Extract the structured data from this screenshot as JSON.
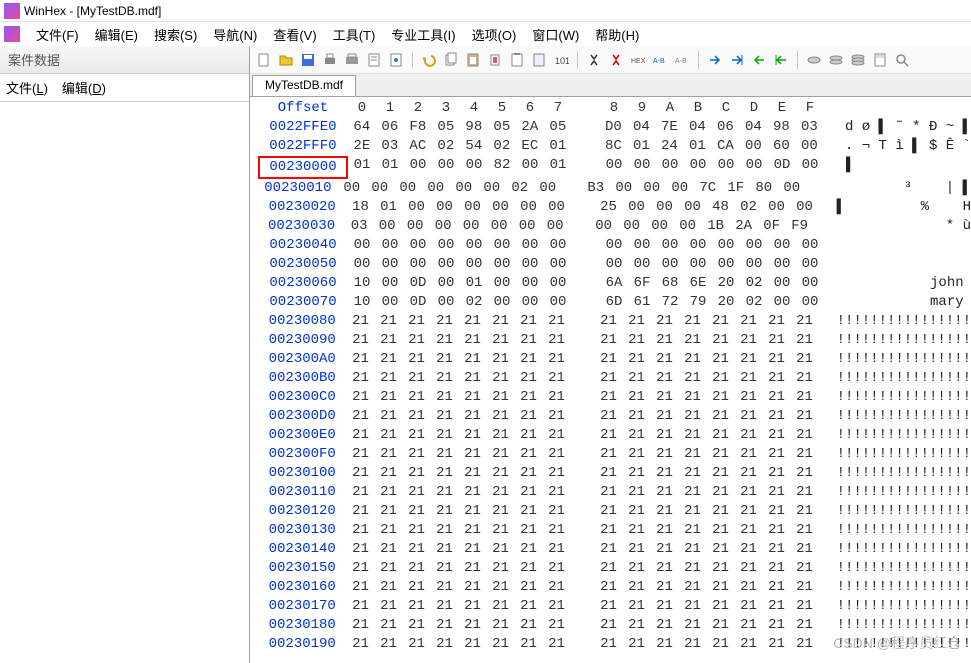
{
  "title": "WinHex - [MyTestDB.mdf]",
  "menus": [
    "文件(F)",
    "编辑(E)",
    "搜索(S)",
    "导航(N)",
    "查看(V)",
    "工具(T)",
    "专业工具(I)",
    "选项(O)",
    "窗口(W)",
    "帮助(H)"
  ],
  "sidebar": {
    "header": "案件数据",
    "items": [
      "文件(L)",
      "编辑(D)"
    ]
  },
  "tab": "MyTestDB.mdf",
  "hex_header": [
    "0",
    "1",
    "2",
    "3",
    "4",
    "5",
    "6",
    "7",
    "8",
    "9",
    "A",
    "B",
    "C",
    "D",
    "E",
    "F"
  ],
  "offset_label": "Offset",
  "toolbar_icons": [
    "new",
    "open",
    "save",
    "print",
    "printer",
    "properties",
    "paste-props",
    "sep",
    "undo",
    "copy",
    "paste",
    "cut",
    "clipboard",
    "clipboard2",
    "binary",
    "sep",
    "find",
    "find-red",
    "hex",
    "hex2",
    "hex3",
    "sep",
    "arrow-right",
    "arrow-right2",
    "arrow-left",
    "arrow-left2",
    "sep",
    "disk1",
    "disk2",
    "disk3",
    "calc",
    "search-glass"
  ],
  "rows": [
    {
      "offset": "0022FFE0",
      "b1": [
        "64",
        "06",
        "F8",
        "05",
        "98",
        "05",
        "2A",
        "05"
      ],
      "b2": [
        "D0",
        "04",
        "7E",
        "04",
        "06",
        "04",
        "98",
        "03"
      ],
      "ascii": "d ø ▌ ˜ * Ð ~ ▌"
    },
    {
      "offset": "0022FFF0",
      "b1": [
        "2E",
        "03",
        "AC",
        "02",
        "54",
        "02",
        "EC",
        "01"
      ],
      "b2": [
        "8C",
        "01",
        "24",
        "01",
        "CA",
        "00",
        "60",
        "00"
      ],
      "ascii": ". ¬ T ì ▌ $ Ê `"
    },
    {
      "offset": "00230000",
      "b1": [
        "01",
        "01",
        "00",
        "00",
        "00",
        "82",
        "00",
        "01"
      ],
      "b2": [
        "00",
        "00",
        "00",
        "00",
        "00",
        "00",
        "0D",
        "00"
      ],
      "ascii": "▌",
      "hl": true
    },
    {
      "offset": "00230010",
      "b1": [
        "00",
        "00",
        "00",
        "00",
        "00",
        "00",
        "02",
        "00"
      ],
      "b2": [
        "B3",
        "00",
        "00",
        "00",
        "7C",
        "1F",
        "80",
        "00"
      ],
      "ascii": "          ³    | ▌"
    },
    {
      "offset": "00230020",
      "b1": [
        "18",
        "01",
        "00",
        "00",
        "00",
        "00",
        "00",
        "00"
      ],
      "b2": [
        "25",
        "00",
        "00",
        "00",
        "48",
        "02",
        "00",
        "00"
      ],
      "ascii": "▌         %    H"
    },
    {
      "offset": "00230030",
      "b1": [
        "03",
        "00",
        "00",
        "00",
        "00",
        "00",
        "00",
        "00"
      ],
      "b2": [
        "00",
        "00",
        "00",
        "00",
        "1B",
        "2A",
        "0F",
        "F9"
      ],
      "ascii": "              * ù"
    },
    {
      "offset": "00230040",
      "b1": [
        "00",
        "00",
        "00",
        "00",
        "00",
        "00",
        "00",
        "00"
      ],
      "b2": [
        "00",
        "00",
        "00",
        "00",
        "00",
        "00",
        "00",
        "00"
      ],
      "ascii": ""
    },
    {
      "offset": "00230050",
      "b1": [
        "00",
        "00",
        "00",
        "00",
        "00",
        "00",
        "00",
        "00"
      ],
      "b2": [
        "00",
        "00",
        "00",
        "00",
        "00",
        "00",
        "00",
        "00"
      ],
      "ascii": ""
    },
    {
      "offset": "00230060",
      "b1": [
        "10",
        "00",
        "0D",
        "00",
        "01",
        "00",
        "00",
        "00"
      ],
      "b2": [
        "6A",
        "6F",
        "68",
        "6E",
        "20",
        "02",
        "00",
        "00"
      ],
      "ascii": "          john"
    },
    {
      "offset": "00230070",
      "b1": [
        "10",
        "00",
        "0D",
        "00",
        "02",
        "00",
        "00",
        "00"
      ],
      "b2": [
        "6D",
        "61",
        "72",
        "79",
        "20",
        "02",
        "00",
        "00"
      ],
      "ascii": "          mary"
    },
    {
      "offset": "00230080",
      "b1": [
        "21",
        "21",
        "21",
        "21",
        "21",
        "21",
        "21",
        "21"
      ],
      "b2": [
        "21",
        "21",
        "21",
        "21",
        "21",
        "21",
        "21",
        "21"
      ],
      "ascii": "!!!!!!!!!!!!!!!!"
    },
    {
      "offset": "00230090",
      "b1": [
        "21",
        "21",
        "21",
        "21",
        "21",
        "21",
        "21",
        "21"
      ],
      "b2": [
        "21",
        "21",
        "21",
        "21",
        "21",
        "21",
        "21",
        "21"
      ],
      "ascii": "!!!!!!!!!!!!!!!!"
    },
    {
      "offset": "002300A0",
      "b1": [
        "21",
        "21",
        "21",
        "21",
        "21",
        "21",
        "21",
        "21"
      ],
      "b2": [
        "21",
        "21",
        "21",
        "21",
        "21",
        "21",
        "21",
        "21"
      ],
      "ascii": "!!!!!!!!!!!!!!!!"
    },
    {
      "offset": "002300B0",
      "b1": [
        "21",
        "21",
        "21",
        "21",
        "21",
        "21",
        "21",
        "21"
      ],
      "b2": [
        "21",
        "21",
        "21",
        "21",
        "21",
        "21",
        "21",
        "21"
      ],
      "ascii": "!!!!!!!!!!!!!!!!"
    },
    {
      "offset": "002300C0",
      "b1": [
        "21",
        "21",
        "21",
        "21",
        "21",
        "21",
        "21",
        "21"
      ],
      "b2": [
        "21",
        "21",
        "21",
        "21",
        "21",
        "21",
        "21",
        "21"
      ],
      "ascii": "!!!!!!!!!!!!!!!!"
    },
    {
      "offset": "002300D0",
      "b1": [
        "21",
        "21",
        "21",
        "21",
        "21",
        "21",
        "21",
        "21"
      ],
      "b2": [
        "21",
        "21",
        "21",
        "21",
        "21",
        "21",
        "21",
        "21"
      ],
      "ascii": "!!!!!!!!!!!!!!!!"
    },
    {
      "offset": "002300E0",
      "b1": [
        "21",
        "21",
        "21",
        "21",
        "21",
        "21",
        "21",
        "21"
      ],
      "b2": [
        "21",
        "21",
        "21",
        "21",
        "21",
        "21",
        "21",
        "21"
      ],
      "ascii": "!!!!!!!!!!!!!!!!"
    },
    {
      "offset": "002300F0",
      "b1": [
        "21",
        "21",
        "21",
        "21",
        "21",
        "21",
        "21",
        "21"
      ],
      "b2": [
        "21",
        "21",
        "21",
        "21",
        "21",
        "21",
        "21",
        "21"
      ],
      "ascii": "!!!!!!!!!!!!!!!!"
    },
    {
      "offset": "00230100",
      "b1": [
        "21",
        "21",
        "21",
        "21",
        "21",
        "21",
        "21",
        "21"
      ],
      "b2": [
        "21",
        "21",
        "21",
        "21",
        "21",
        "21",
        "21",
        "21"
      ],
      "ascii": "!!!!!!!!!!!!!!!!"
    },
    {
      "offset": "00230110",
      "b1": [
        "21",
        "21",
        "21",
        "21",
        "21",
        "21",
        "21",
        "21"
      ],
      "b2": [
        "21",
        "21",
        "21",
        "21",
        "21",
        "21",
        "21",
        "21"
      ],
      "ascii": "!!!!!!!!!!!!!!!!"
    },
    {
      "offset": "00230120",
      "b1": [
        "21",
        "21",
        "21",
        "21",
        "21",
        "21",
        "21",
        "21"
      ],
      "b2": [
        "21",
        "21",
        "21",
        "21",
        "21",
        "21",
        "21",
        "21"
      ],
      "ascii": "!!!!!!!!!!!!!!!!"
    },
    {
      "offset": "00230130",
      "b1": [
        "21",
        "21",
        "21",
        "21",
        "21",
        "21",
        "21",
        "21"
      ],
      "b2": [
        "21",
        "21",
        "21",
        "21",
        "21",
        "21",
        "21",
        "21"
      ],
      "ascii": "!!!!!!!!!!!!!!!!"
    },
    {
      "offset": "00230140",
      "b1": [
        "21",
        "21",
        "21",
        "21",
        "21",
        "21",
        "21",
        "21"
      ],
      "b2": [
        "21",
        "21",
        "21",
        "21",
        "21",
        "21",
        "21",
        "21"
      ],
      "ascii": "!!!!!!!!!!!!!!!!"
    },
    {
      "offset": "00230150",
      "b1": [
        "21",
        "21",
        "21",
        "21",
        "21",
        "21",
        "21",
        "21"
      ],
      "b2": [
        "21",
        "21",
        "21",
        "21",
        "21",
        "21",
        "21",
        "21"
      ],
      "ascii": "!!!!!!!!!!!!!!!!"
    },
    {
      "offset": "00230160",
      "b1": [
        "21",
        "21",
        "21",
        "21",
        "21",
        "21",
        "21",
        "21"
      ],
      "b2": [
        "21",
        "21",
        "21",
        "21",
        "21",
        "21",
        "21",
        "21"
      ],
      "ascii": "!!!!!!!!!!!!!!!!"
    },
    {
      "offset": "00230170",
      "b1": [
        "21",
        "21",
        "21",
        "21",
        "21",
        "21",
        "21",
        "21"
      ],
      "b2": [
        "21",
        "21",
        "21",
        "21",
        "21",
        "21",
        "21",
        "21"
      ],
      "ascii": "!!!!!!!!!!!!!!!!"
    },
    {
      "offset": "00230180",
      "b1": [
        "21",
        "21",
        "21",
        "21",
        "21",
        "21",
        "21",
        "21"
      ],
      "b2": [
        "21",
        "21",
        "21",
        "21",
        "21",
        "21",
        "21",
        "21"
      ],
      "ascii": "!!!!!!!!!!!!!!!!"
    },
    {
      "offset": "00230190",
      "b1": [
        "21",
        "21",
        "21",
        "21",
        "21",
        "21",
        "21",
        "21"
      ],
      "b2": [
        "21",
        "21",
        "21",
        "21",
        "21",
        "21",
        "21",
        "21"
      ],
      "ascii": "!!!!!!!!!!!!!!!!"
    }
  ],
  "watermark": "CSDN @程序员红仓"
}
